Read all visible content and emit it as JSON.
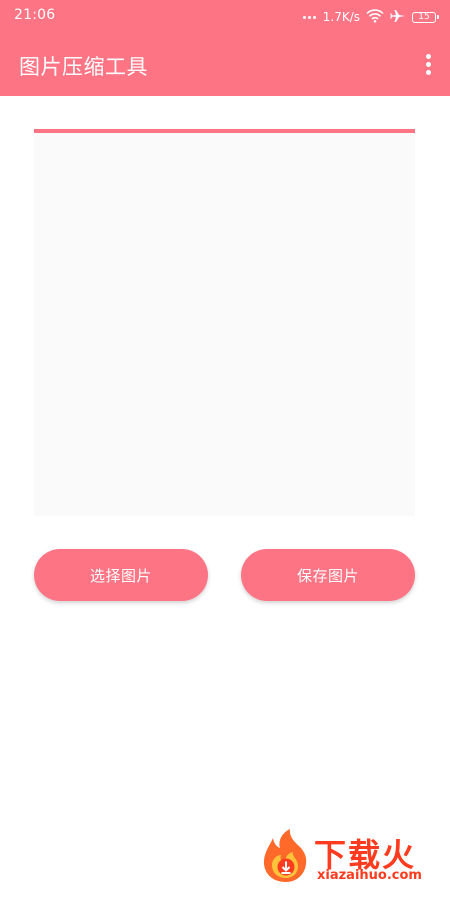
{
  "colors": {
    "accent": "#fd7585",
    "panel": "#fafafa",
    "watermark": "#ff3b1f"
  },
  "status_bar": {
    "time": "21:06",
    "network_speed": "1.7K/s",
    "battery_level": "15",
    "icons": [
      "more-dots-icon",
      "wifi-icon",
      "airplane-icon",
      "battery-icon"
    ]
  },
  "app_bar": {
    "title": "图片压缩工具",
    "menu_icon": "overflow-menu-icon"
  },
  "actions": {
    "select_image_label": "选择图片",
    "save_image_label": "保存图片"
  },
  "watermark": {
    "brand": "下载火",
    "domain": "xiazaihuo.com"
  }
}
